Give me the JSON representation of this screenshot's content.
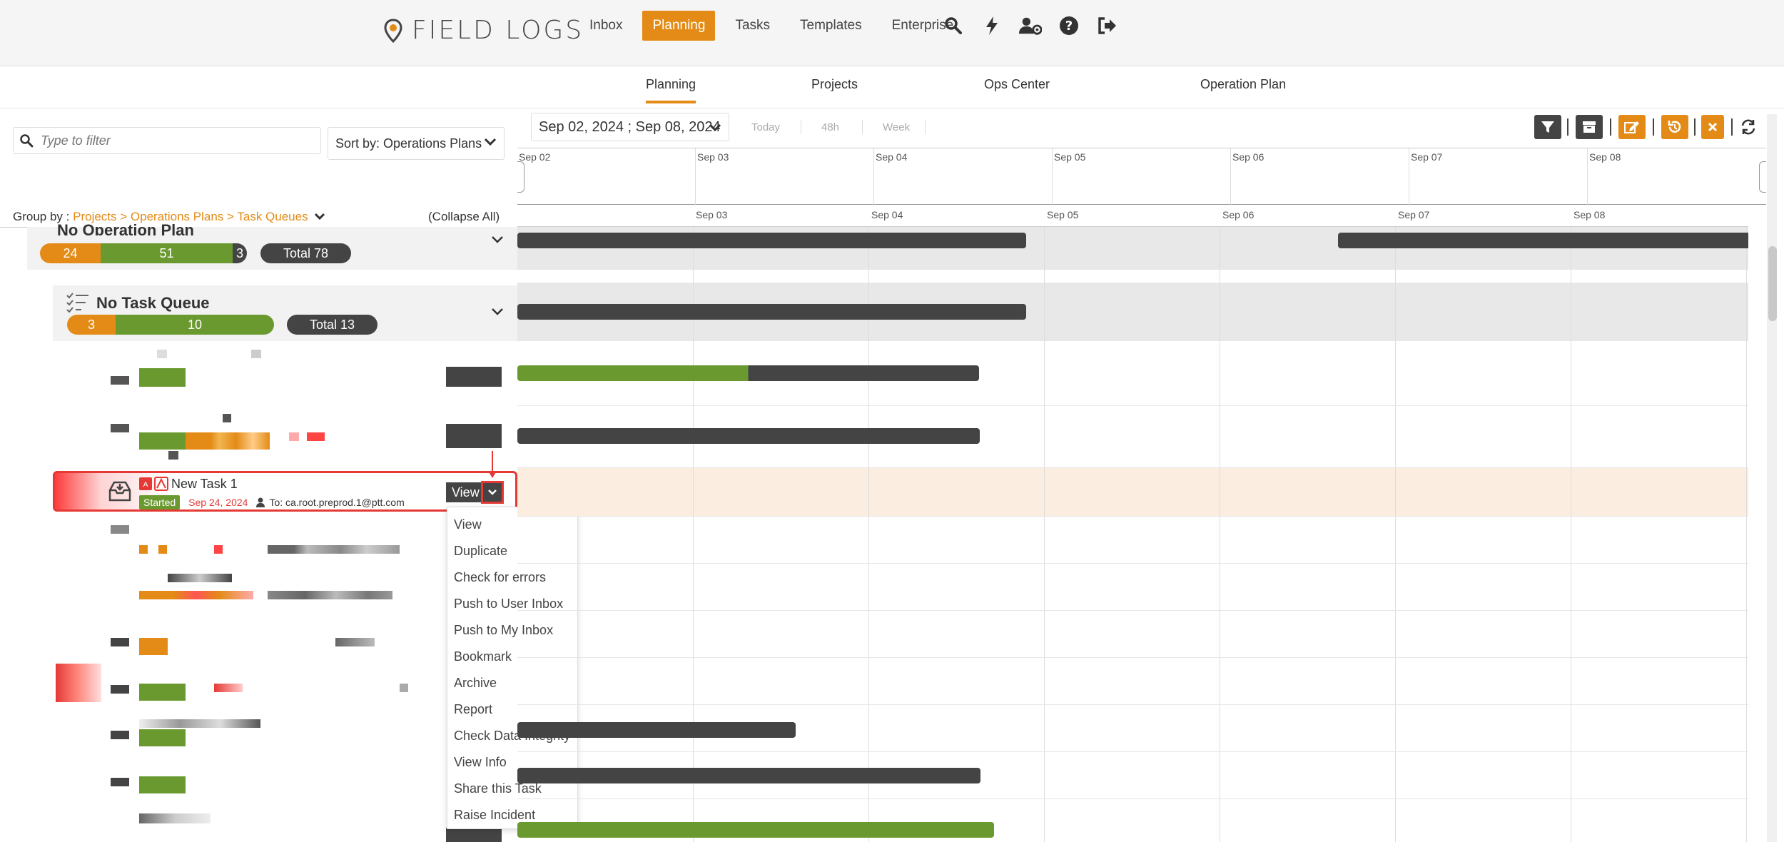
{
  "app": {
    "logo_text": "FIELD LOGS"
  },
  "nav": {
    "items": [
      {
        "label": "Inbox",
        "active": false
      },
      {
        "label": "Planning",
        "active": true
      },
      {
        "label": "Tasks",
        "active": false
      },
      {
        "label": "Templates",
        "active": false
      },
      {
        "label": "Enterprise",
        "active": false
      }
    ],
    "icons": [
      "search-icon",
      "bolt-icon",
      "users-settings-icon",
      "help-icon",
      "logout-icon"
    ]
  },
  "subnav": {
    "tabs": [
      {
        "label": "Planning",
        "active": true
      },
      {
        "label": "Projects",
        "active": false
      },
      {
        "label": "Ops Center",
        "active": false
      },
      {
        "label": "Operation Plan",
        "active": false
      }
    ]
  },
  "left": {
    "filter_placeholder": "Type to filter",
    "sort_label": "Sort by: Operations Plans",
    "group_by_prefix": "Group by : ",
    "group_by_path": "Projects > Operations Plans > Task Queues",
    "collapse_all": "(Collapse All)",
    "group1": {
      "title": "No Operation Plan",
      "counts": [
        "24",
        "51",
        "3"
      ],
      "total": "Total 78"
    },
    "group2": {
      "title": "No Task Queue",
      "counts": [
        "3",
        "10"
      ],
      "total": "Total 13"
    },
    "selected_task": {
      "name": "New Task 1",
      "status": "Started",
      "date": "Sep 24, 2024",
      "assignee": "To: ca.root.preprod.1@ptt.com",
      "view_label": "View"
    }
  },
  "context_menu": {
    "items": [
      "View",
      "Duplicate",
      "Check for errors",
      "Push to User Inbox",
      "Push to My Inbox",
      "Bookmark",
      "Archive",
      "Report",
      "Check Data Integrity",
      "View Info",
      "Share this Task",
      "Raise Incident"
    ]
  },
  "timeline": {
    "date_range": "Sep 02, 2024 ; Sep 08, 2024",
    "range_buttons": [
      "Today",
      "48h",
      "Week"
    ],
    "top_days": [
      "Sep 02",
      "Sep 03",
      "Sep 04",
      "Sep 05",
      "Sep 06",
      "Sep 07",
      "Sep 08"
    ],
    "header_days": [
      "Sep 03",
      "Sep 04",
      "Sep 05",
      "Sep 06",
      "Sep 07",
      "Sep 08"
    ]
  },
  "colors": {
    "accent": "#e38b16",
    "green": "#6a9a2f",
    "dark": "#444444",
    "red": "#e53935"
  }
}
